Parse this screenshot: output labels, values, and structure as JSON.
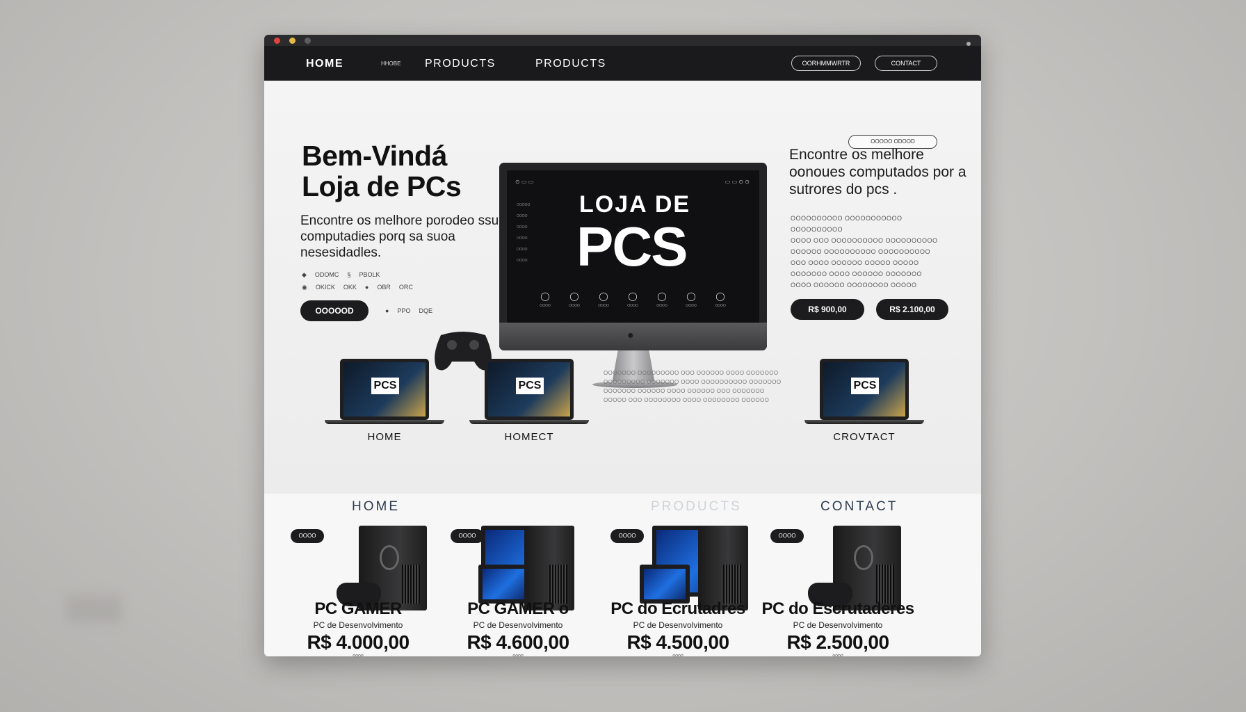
{
  "nav": {
    "home": "HOME",
    "tag_small": "HHOBE",
    "products_1": "PRODUCTS",
    "products_2": "PRODUCTS",
    "pill_1": "OORHMMWRTR",
    "pill_2": "CONTACT"
  },
  "hero": {
    "title_line1": "Bem-Vindá",
    "title_line2": "Loja de PCs",
    "subtitle": "Encontre os melhore porodeo ssuo computadies porq sa suoa nesesidadles.",
    "icon_row_1": [
      "ODOMC",
      "PBOLK"
    ],
    "icon_row_2": [
      "OKICK",
      "OKK",
      "OBR",
      "ORC"
    ],
    "icon_row_3": [
      "PPO",
      "DQE"
    ],
    "cta_button": "OOOOOD",
    "search_pill": "OOOOO ODOOD"
  },
  "monitor": {
    "screen_title": "LOJA DE",
    "screen_big": "PCS",
    "menu": [
      "OOOOO",
      "OOOO",
      "OOOO",
      "OOOO",
      "OOOO",
      "OOOO"
    ],
    "icons": [
      "OOOO",
      "OOOO",
      "OOOO",
      "OOOO",
      "OOOO",
      "OOOO",
      "OOOO"
    ]
  },
  "right": {
    "title": "Encontre os melhore oonoues computados por a sutrores do pcs .",
    "lines": [
      "OOOOOOOOOO OOOOOOOOOOO OOOOOOOOOO",
      "OOOO OOO OOOOOOOOOO OOOOOOOOOO",
      "OOOOOO OOOOOOOOOO OOOOOOOOOO",
      "OOO OOOO OOOOOO OOOOO OOOOO",
      "OOOOOOO OOOO OOOOOO OOOOOOO",
      "OOOO OOOOOO OOOOOOOO OOOOO"
    ],
    "price_btn_1": "R$ 900,00",
    "price_btn_2": "R$ 2.100,00"
  },
  "laptops": [
    {
      "logo": "PCS",
      "label": "HOME"
    },
    {
      "logo": "PCS",
      "label": "HOMECT"
    },
    {
      "logo": "PCS",
      "label": "CROVTACT"
    }
  ],
  "mid_text": "OOOOOOO OOOOOOOOO OOO OOOOOO OOOO OOOOOOO OOOOOOOOO OOOOOOO OOOO OOOOOOOOOO OOOOOOO OOOOOOO OOOOOO OOOO OOOOOO OOO OOOOOOO OOOOO OOO OOOOOOOO OOOO OOOOOOOO OOOOOO",
  "sections": {
    "home": "HOME",
    "products": "PRODUCTS",
    "contact": "CONTACT"
  },
  "products": [
    {
      "tag": "OOOO",
      "title": "PC GAMER",
      "subtitle": "PC de Desenvolvimento",
      "price": "R$ 4.000,00",
      "note": "oooo"
    },
    {
      "tag": "OOOO",
      "title": "PC GAMER o",
      "subtitle": "PC de Desenvolvimento",
      "price": "R$ 4.600,00",
      "note": "oooo"
    },
    {
      "tag": "OOOO",
      "title": "PC do Ecrutadres",
      "subtitle": "PC de Desenvolvimento",
      "price": "R$ 4.500,00",
      "note": "oooo"
    },
    {
      "tag": "OOOO",
      "title": "PC do Escrutaderes",
      "subtitle": "PC de Desenvolvimento",
      "price": "R$ 2.500,00",
      "note": "oooo"
    }
  ]
}
